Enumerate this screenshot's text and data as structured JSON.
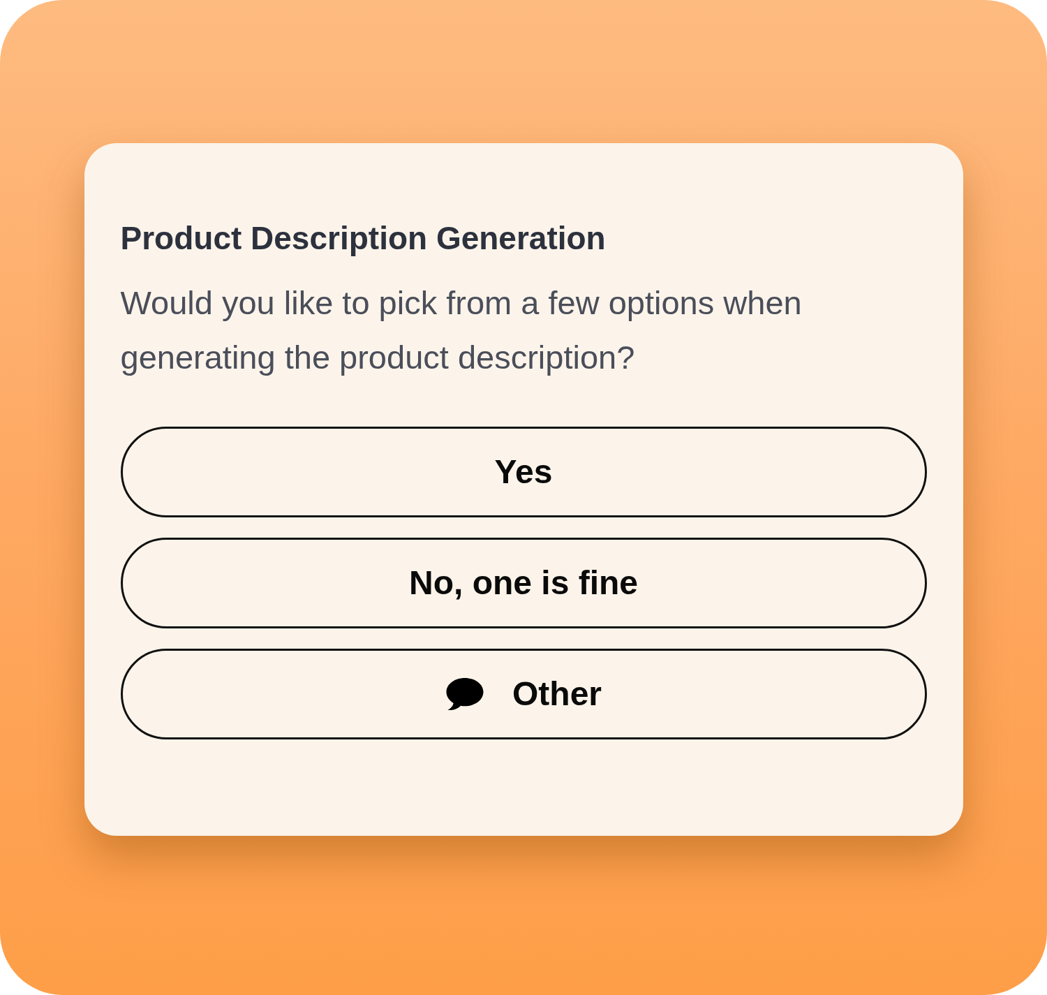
{
  "card": {
    "title": "Product Description Generation",
    "question": "Would you like to pick from a few options when generating the product description?",
    "options": [
      {
        "label": "Yes",
        "kind": "answer"
      },
      {
        "label": "No, one is fine",
        "kind": "answer"
      },
      {
        "label": "Other",
        "kind": "custom"
      }
    ]
  }
}
